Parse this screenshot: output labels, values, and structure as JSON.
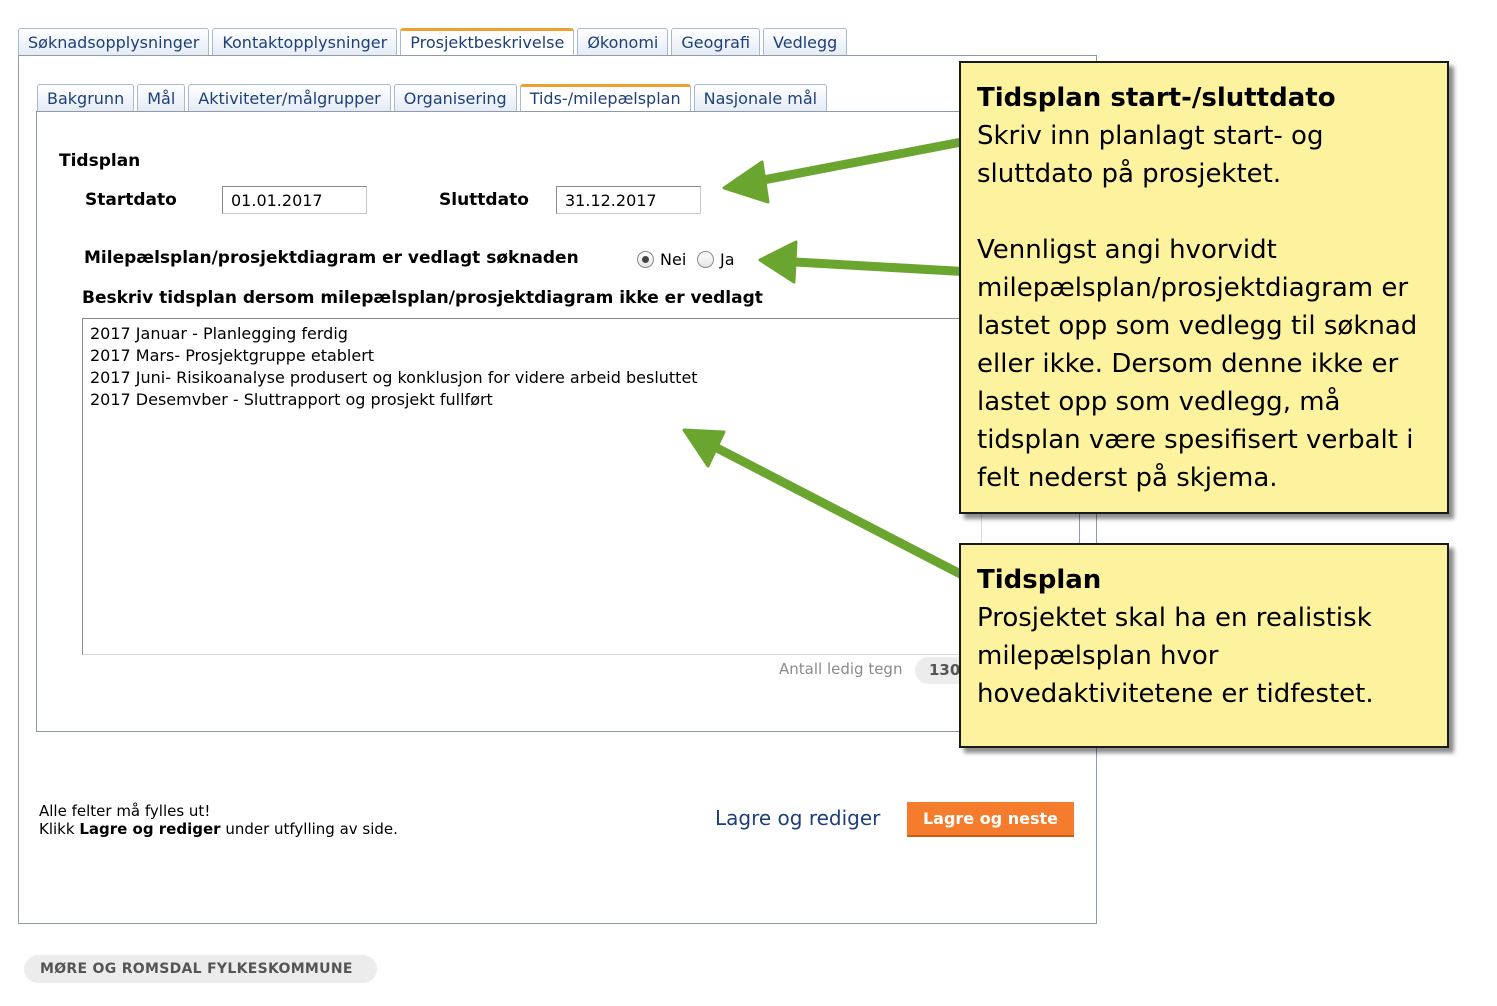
{
  "top_tabs": [
    "Søknadsopplysninger",
    "Kontaktopplysninger",
    "Prosjektbeskrivelse",
    "Økonomi",
    "Geografi",
    "Vedlegg"
  ],
  "sub_tabs": [
    "Bakgrunn",
    "Mål",
    "Aktiviteter/målgrupper",
    "Organisering",
    "Tids-/milepælsplan",
    "Nasjonale mål"
  ],
  "form": {
    "section_title": "Tidsplan",
    "start_label": "Startdato",
    "start_value": "01.01.2017",
    "end_label": "Sluttdato",
    "end_value": "31.12.2017",
    "attached_question": "Milepælsplan/prosjektdiagram er vedlagt søknaden",
    "radio_no": "Nei",
    "radio_yes": "Ja",
    "radio_selected": "Nei",
    "description_label": "Beskriv tidsplan dersom milepælsplan/prosjektdiagram ikke er vedlagt",
    "description_value": "2017 Januar - Planlegging ferdig\n2017 Mars- Prosjektgruppe etablert\n2017 Juni- Risikoanalyse produsert og konklusjon for videre arbeid besluttet\n2017 Desemvber - Sluttrapport og prosjekt fullført",
    "counter_label": "Antall ledig tegn",
    "counter_value": "130"
  },
  "bottom": {
    "required_note": "Alle felter må fylles ut!",
    "hint_prefix": "Klikk ",
    "hint_bold": "Lagre og rediger",
    "hint_suffix": " under utfylling av side.",
    "save_edit_label": "Lagre og rediger",
    "save_next_label": "Lagre og neste"
  },
  "footer": "MØRE OG ROMSDAL FYLKESKOMMUNE",
  "callouts": {
    "dates": {
      "title": "Tidsplan start-/sluttdato",
      "text1": "Skriv inn planlagt start- og sluttdato på prosjektet.",
      "text2": "Vennligst angi hvorvidt milepælsplan/prosjektdiagram er lastet opp som vedlegg til søknad eller ikke. Dersom denne ikke er lastet opp som vedlegg, må tidsplan være spesifisert verbalt i felt nederst på skjema."
    },
    "plan": {
      "title": "Tidsplan",
      "text": "Prosjektet skal ha en realistisk milepælsplan hvor hovedaktivitetene er tidfestet."
    }
  },
  "colors": {
    "accent_orange": "#f57c2c",
    "tab_text": "#1f3f78",
    "callout_bg": "#fdf29e",
    "arrow_green": "#6aa62f"
  }
}
